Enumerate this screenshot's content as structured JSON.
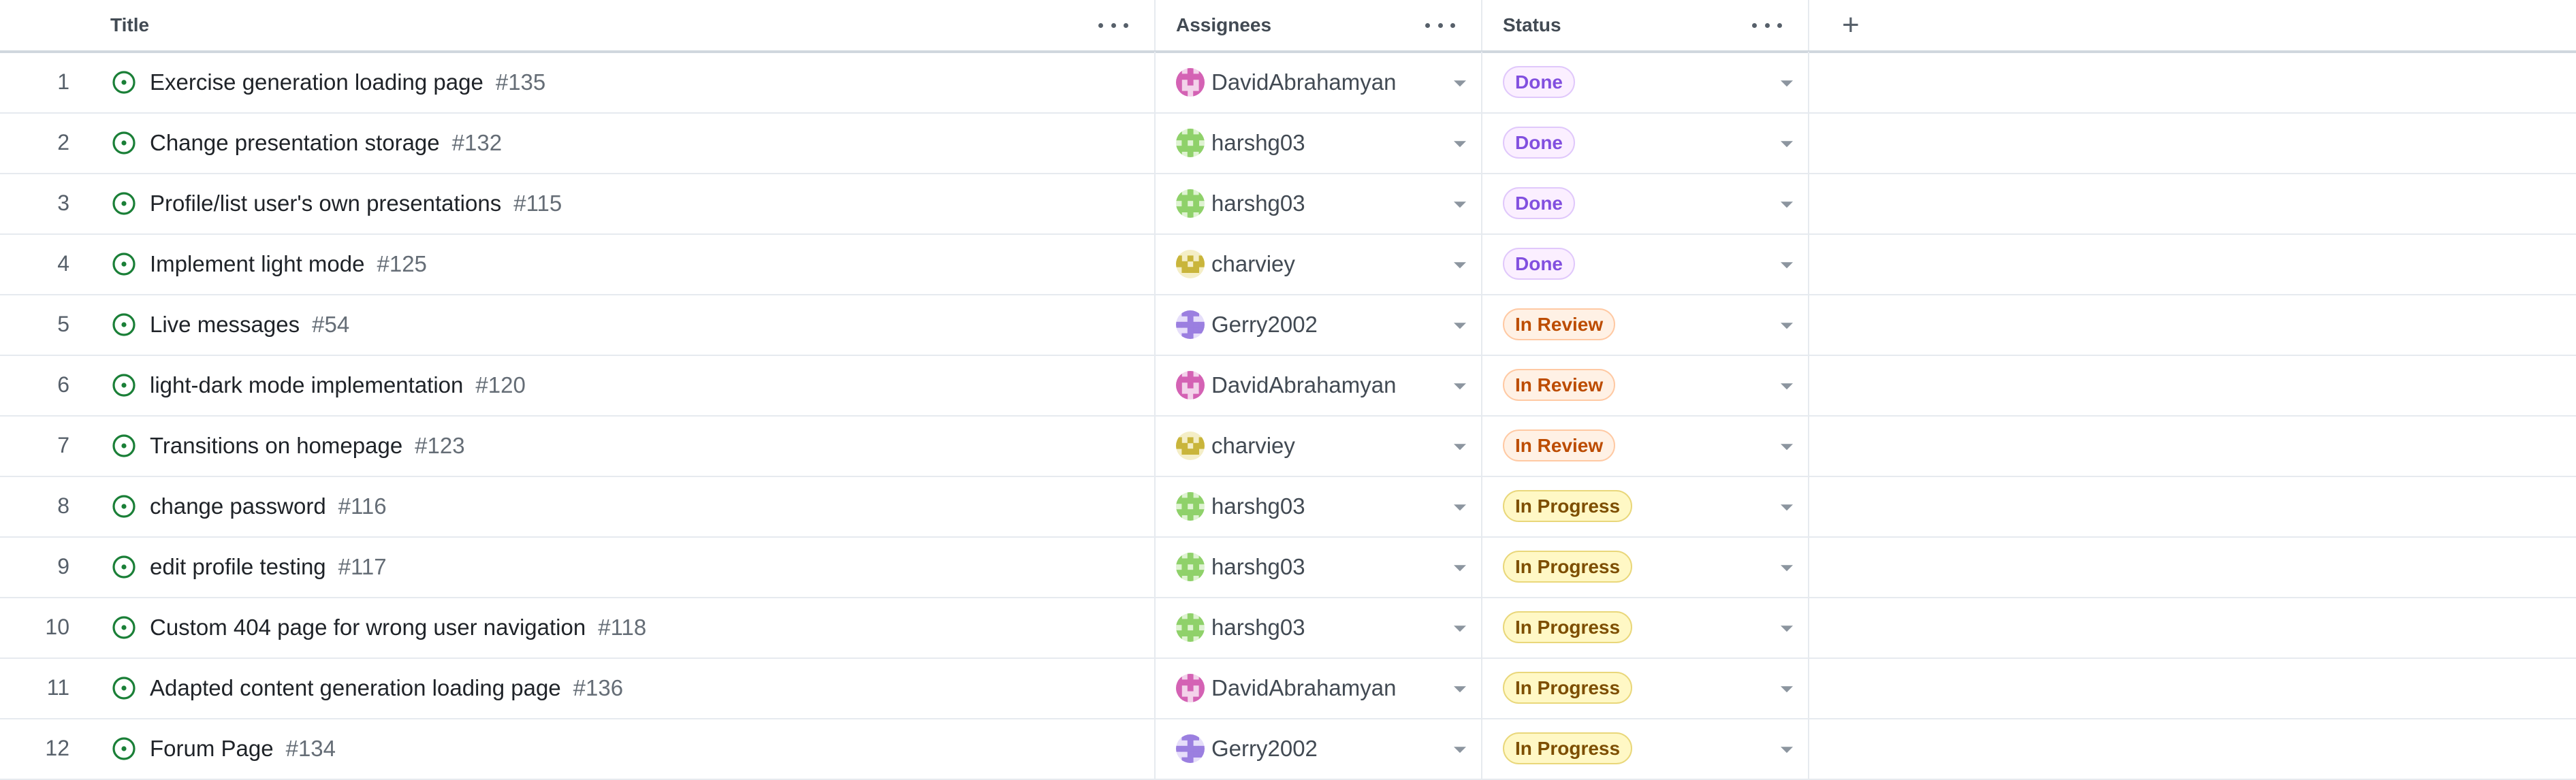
{
  "header": {
    "title_label": "Title",
    "assignees_label": "Assignees",
    "status_label": "Status"
  },
  "colors": {
    "done": "#8250df",
    "in_review": "#bc4c00",
    "in_progress": "#7d4e00",
    "open_issue": "#1a7f37"
  },
  "rows": [
    {
      "num": "1",
      "title": "Exercise generation loading page",
      "issue": "#135",
      "assignee": "DavidAbrahamyan",
      "status": "Done"
    },
    {
      "num": "2",
      "title": "Change presentation storage",
      "issue": "#132",
      "assignee": "harshg03",
      "status": "Done"
    },
    {
      "num": "3",
      "title": "Profile/list user's own presentations",
      "issue": "#115",
      "assignee": "harshg03",
      "status": "Done"
    },
    {
      "num": "4",
      "title": "Implement light mode",
      "issue": "#125",
      "assignee": "charviey",
      "status": "Done"
    },
    {
      "num": "5",
      "title": "Live messages",
      "issue": "#54",
      "assignee": "Gerry2002",
      "status": "In Review"
    },
    {
      "num": "6",
      "title": "light-dark mode implementation",
      "issue": "#120",
      "assignee": "DavidAbrahamyan",
      "status": "In Review"
    },
    {
      "num": "7",
      "title": "Transitions on homepage",
      "issue": "#123",
      "assignee": "charviey",
      "status": "In Review"
    },
    {
      "num": "8",
      "title": "change password",
      "issue": "#116",
      "assignee": "harshg03",
      "status": "In Progress"
    },
    {
      "num": "9",
      "title": "edit profile testing",
      "issue": "#117",
      "assignee": "harshg03",
      "status": "In Progress"
    },
    {
      "num": "10",
      "title": "Custom 404 page for wrong user navigation",
      "issue": "#118",
      "assignee": "harshg03",
      "status": "In Progress"
    },
    {
      "num": "11",
      "title": "Adapted content generation loading page",
      "issue": "#136",
      "assignee": "DavidAbrahamyan",
      "status": "In Progress"
    },
    {
      "num": "12",
      "title": "Forum Page",
      "issue": "#134",
      "assignee": "Gerry2002",
      "status": "In Progress"
    }
  ]
}
